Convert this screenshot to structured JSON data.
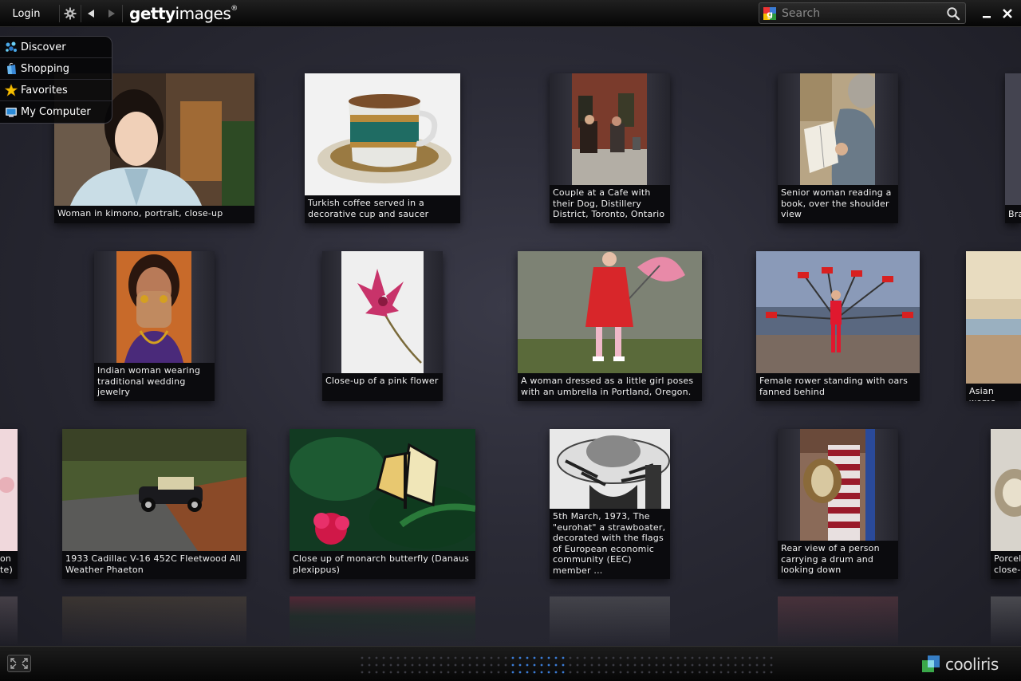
{
  "toolbar": {
    "login_label": "Login",
    "settings_icon": "gear-icon",
    "back_icon": "back-arrow-icon",
    "forward_icon": "forward-arrow-icon",
    "logo_bold": "getty",
    "logo_rest": "images",
    "logo_mark": "®",
    "search_placeholder": "Search",
    "minimize_icon": "minimize-icon",
    "close_icon": "close-icon"
  },
  "menu": {
    "items": [
      {
        "label": "Discover",
        "icon": "discover-icon"
      },
      {
        "label": "Shopping",
        "icon": "shopping-bag-icon"
      },
      {
        "label": "Favorites",
        "icon": "star-icon"
      },
      {
        "label": "My Computer",
        "icon": "computer-icon"
      }
    ]
  },
  "tiles": [
    {
      "caption": "Woman in kimono, portrait, close-up"
    },
    {
      "caption": "Turkish coffee served in a decorative cup and saucer"
    },
    {
      "caption": "Couple at a Cafe with their Dog, Distillery District, Toronto, Ontario"
    },
    {
      "caption": "Senior woman reading a book, over the shoulder view"
    },
    {
      "caption": "Bra"
    },
    {
      "caption": "Indian woman wearing traditional wedding jewelry"
    },
    {
      "caption": "Close-up of a pink flower"
    },
    {
      "caption": "A woman dressed as a little girl poses with an umbrella in Portland, Oregon."
    },
    {
      "caption": "Female rower standing with oars fanned behind"
    },
    {
      "caption": "Asian woma"
    },
    {
      "caption": "on te)"
    },
    {
      "caption": "1933 Cadillac V-16 452C Fleetwood All Weather Phaeton"
    },
    {
      "caption": "Close up of monarch butterfly (Danaus plexippus)"
    },
    {
      "caption": "5th March, 1973, The \"eurohat\" a strawboater, decorated with the flags of European economic community (EEC) member ..."
    },
    {
      "caption": "Rear view of a person carrying a drum and looking down"
    },
    {
      "caption": "Porcel close-"
    }
  ],
  "footer": {
    "expand_icon": "fullscreen-icon",
    "brand": "cooliris",
    "brand_icon": "cooliris-logo-icon"
  },
  "colors": {
    "accent_blue": "#3a7bd5",
    "caption_bg": "#0b0b0e",
    "background": "#2a2a35"
  }
}
